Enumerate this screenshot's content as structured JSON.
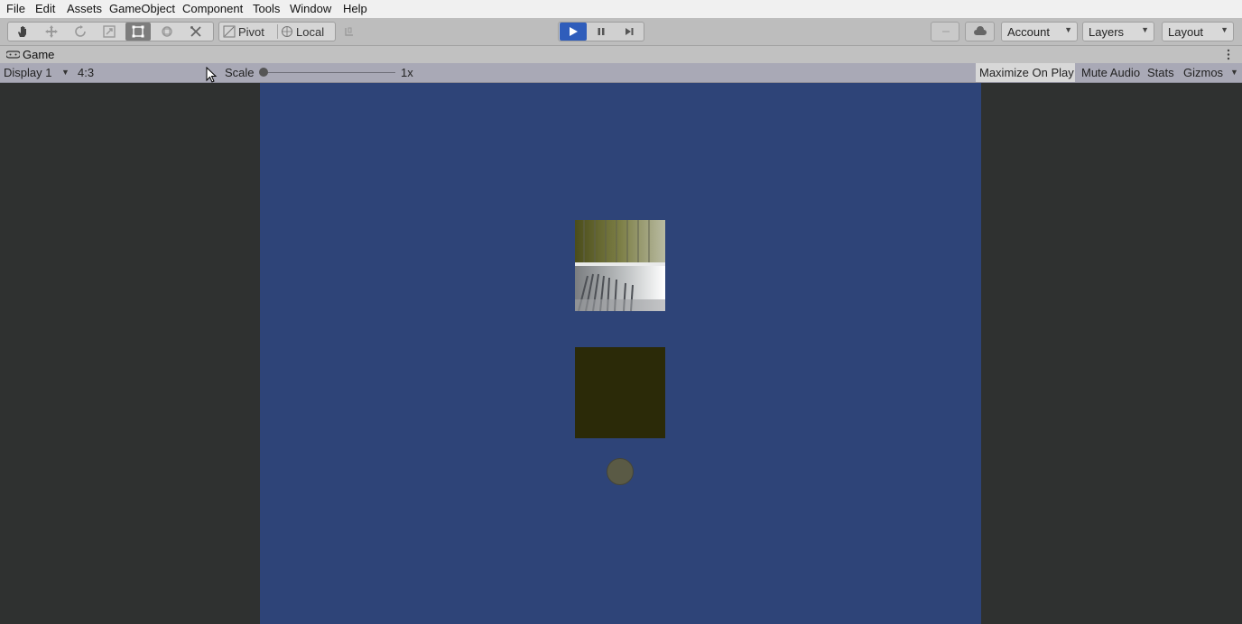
{
  "menu": [
    "File",
    "Edit",
    "Assets",
    "GameObject",
    "Component",
    "Tools",
    "Window",
    "Help"
  ],
  "toolbar": {
    "tools": [
      "hand-tool-icon",
      "move-tool-icon",
      "rotate-tool-icon",
      "scale-tool-icon",
      "rect-tool-icon",
      "transform-tool-icon",
      "custom-tool-icon"
    ],
    "pivot_label": "Pivot",
    "local_label": "Local",
    "account_label": "Account",
    "layers_label": "Layers",
    "layout_label": "Layout"
  },
  "game_tab": {
    "label": "Game"
  },
  "game_toolbar": {
    "display": "Display 1",
    "aspect": "4:3",
    "scale_label": "Scale",
    "scale_value": "1x",
    "maximize_on_play": "Maximize On Play",
    "mute_audio": "Mute Audio",
    "stats": "Stats",
    "gizmos": "Gizmos"
  },
  "colors": {
    "canvas_background": "#2e4478",
    "outer_background": "#2f3130",
    "play_button": "#2f5dbb",
    "dark_panel": "#2b2a08",
    "knob": "#5a5a45"
  }
}
